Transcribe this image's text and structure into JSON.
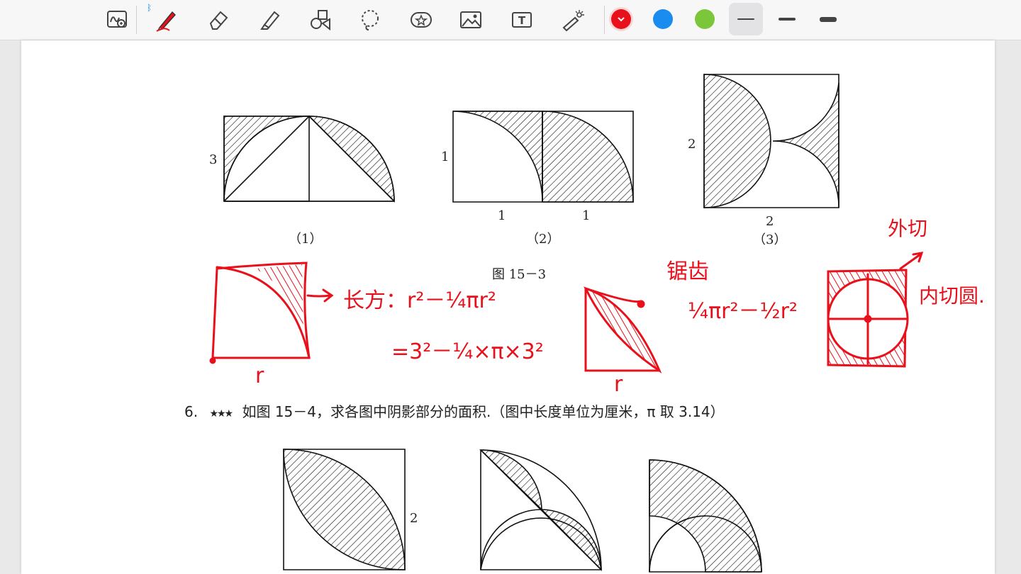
{
  "toolbar": {
    "tools": [
      {
        "name": "zoom-handwriting-tool",
        "icon": "zoom-handwriting-icon"
      },
      {
        "name": "pen-tool",
        "icon": "pen-icon",
        "badge": "bluetooth-icon"
      },
      {
        "name": "eraser-tool",
        "icon": "eraser-icon"
      },
      {
        "name": "highlighter-tool",
        "icon": "highlighter-icon"
      },
      {
        "name": "shapes-tool",
        "icon": "shapes-icon"
      },
      {
        "name": "lasso-tool",
        "icon": "lasso-icon"
      },
      {
        "name": "sticker-tool",
        "icon": "star-sticker-icon"
      },
      {
        "name": "image-tool",
        "icon": "image-icon"
      },
      {
        "name": "text-tool",
        "icon": "text-box-icon"
      },
      {
        "name": "laser-pointer-tool",
        "icon": "laser-pointer-icon"
      }
    ],
    "colors": [
      "#e8101a",
      "#1a8cf0",
      "#7cc63a"
    ],
    "selected_color": "#e8101a",
    "stroke_widths": [
      "thin",
      "medium",
      "thick"
    ],
    "selected_stroke": "thin",
    "text_tool_glyph": "T"
  },
  "figure_15_3": {
    "caption": "图 15－3",
    "sub1": {
      "label": "（1）",
      "side": "3"
    },
    "sub2": {
      "label": "（2）",
      "side_left": "1",
      "bottom_left": "1",
      "bottom_right": "1"
    },
    "sub3": {
      "label": "（3）",
      "side_left": "2",
      "bottom": "2"
    }
  },
  "annotations": {
    "note1_line1": "长方：r²－¼πr²",
    "note1_line2": "=3²－¼×π×3²",
    "note1_r": "r",
    "note2_r": "r",
    "note3_title": "锯齿",
    "note3_formula": "¼πr²－½r²",
    "note4_top": "外切",
    "note4_side": "内切圆."
  },
  "problem6": {
    "number": "6.",
    "stars": "★★★",
    "text": "如图 15－4，求各图中阴影部分的面积.（图中长度单位为厘米，π 取 3.14）",
    "fig1_side": "2"
  }
}
